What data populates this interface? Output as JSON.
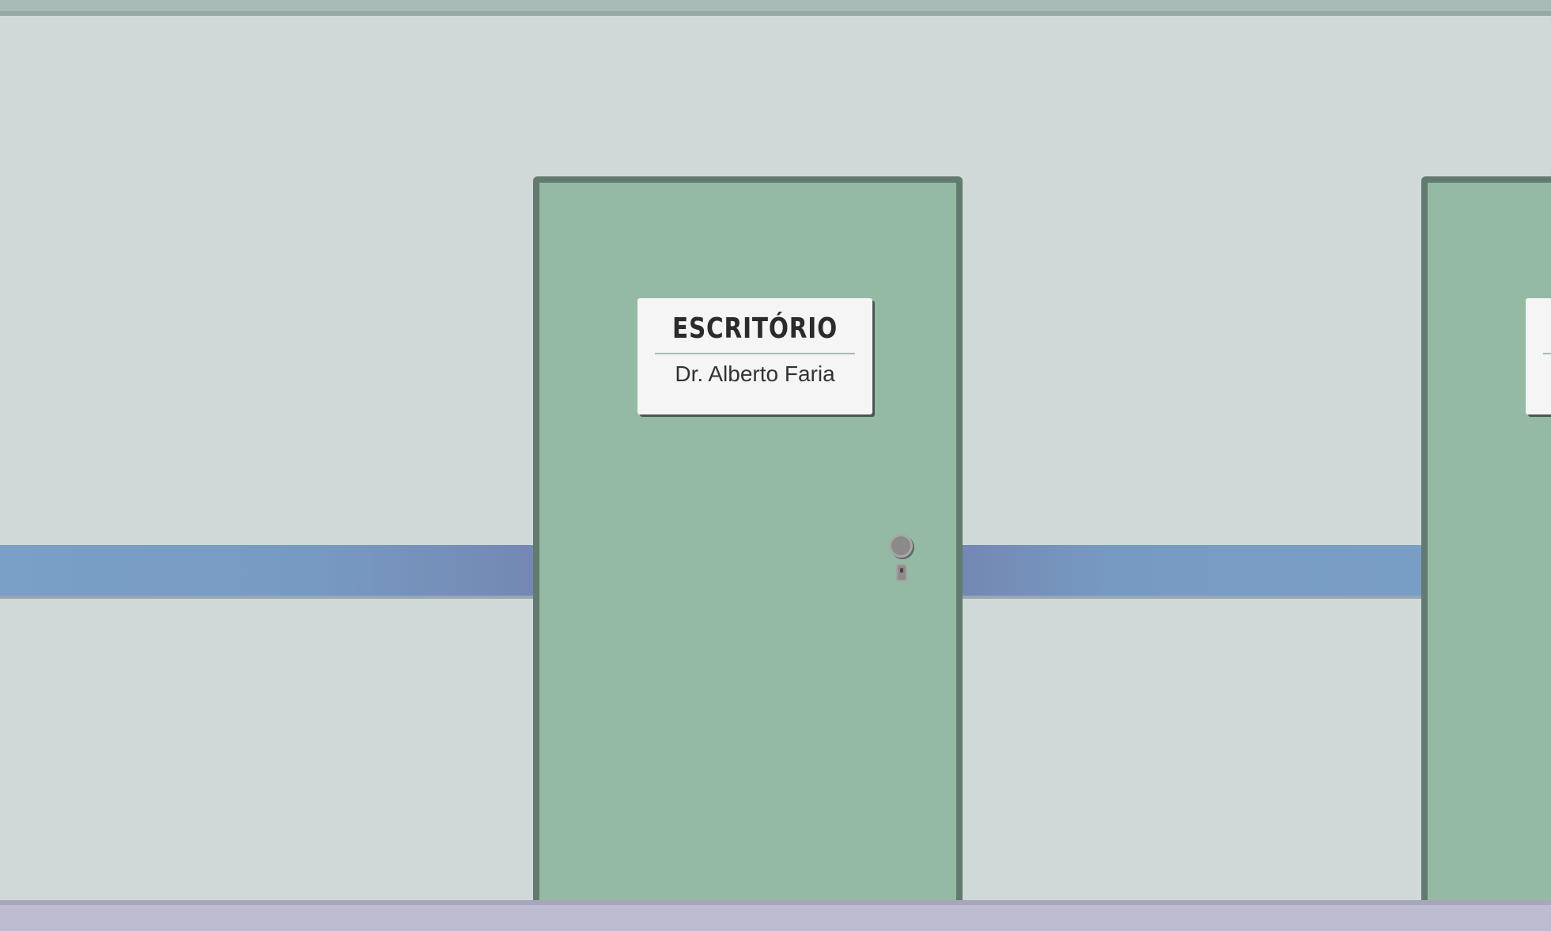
{
  "colors": {
    "wall": "#d0d9d8",
    "rail": "#7aa0c8",
    "door": "#94baa4",
    "door_frame": "#637a70",
    "floor": "#bdbbd0",
    "sign_bg": "#f5f5f5"
  },
  "doors": [
    {
      "sign_title": "ESCRITÓRIO",
      "sign_subtitle": "Dr. Alberto Faria"
    }
  ]
}
